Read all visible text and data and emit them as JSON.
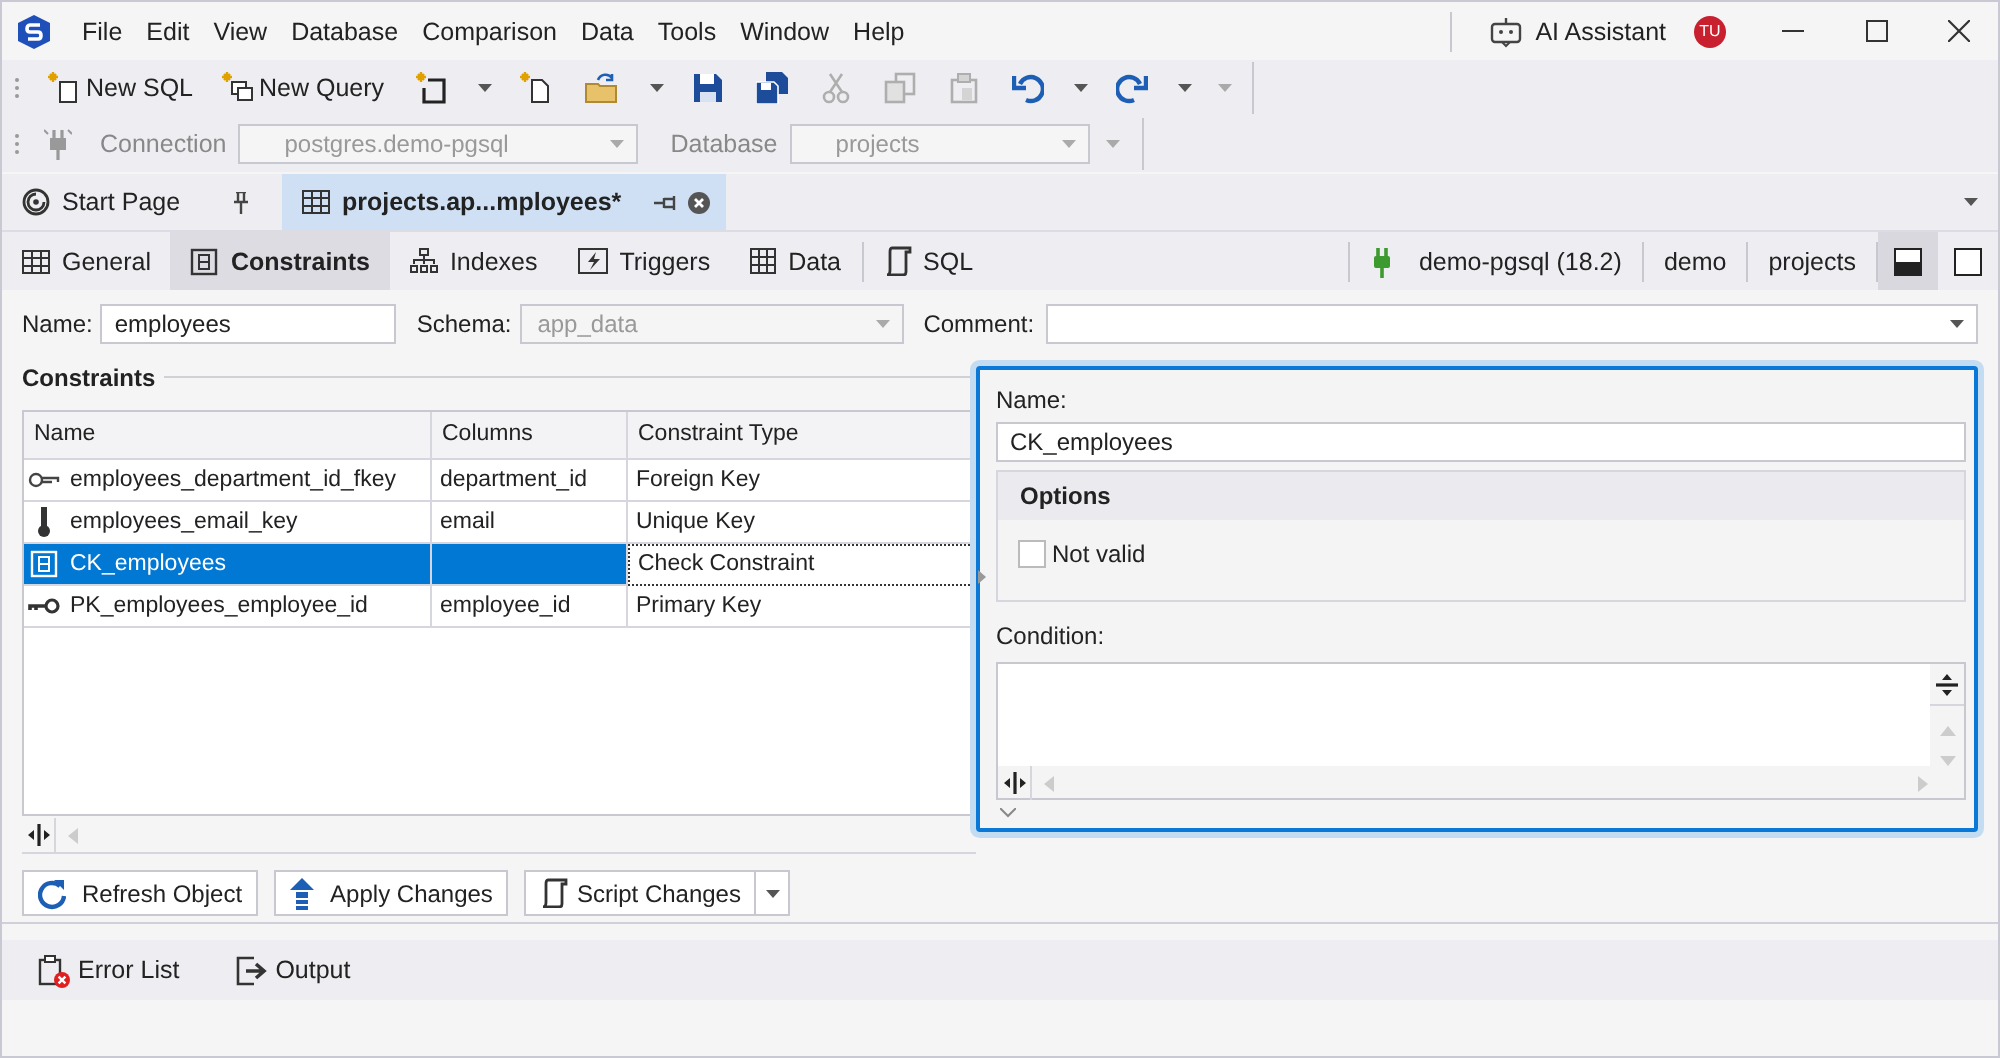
{
  "app": {
    "menu": [
      "File",
      "Edit",
      "View",
      "Database",
      "Comparison",
      "Data",
      "Tools",
      "Window",
      "Help"
    ],
    "ai_assistant": "AI Assistant",
    "user_initials": "TU"
  },
  "toolbar": [
    {
      "kind": "button",
      "label": "New SQL",
      "disabled": false
    },
    {
      "kind": "button",
      "label": "New Query",
      "disabled": false
    },
    {
      "kind": "button",
      "disabled": false
    },
    {
      "kind": "dropdown",
      "disabled": false
    },
    {
      "kind": "button",
      "disabled": false
    },
    {
      "kind": "button",
      "disabled": false
    },
    {
      "kind": "dropdown",
      "disabled": false
    },
    {
      "kind": "button",
      "disabled": false
    },
    {
      "kind": "button",
      "disabled": false
    },
    {
      "kind": "button",
      "disabled": true
    },
    {
      "kind": "button",
      "disabled": true
    },
    {
      "kind": "button",
      "disabled": true
    },
    {
      "kind": "button",
      "disabled": false
    },
    {
      "kind": "dropdown",
      "disabled": false
    },
    {
      "kind": "button",
      "disabled": false
    },
    {
      "kind": "dropdown",
      "disabled": false
    }
  ],
  "connection_bar": {
    "connection_label": "Connection",
    "connection_value": "postgres.demo-pgsql",
    "database_label": "Database",
    "database_value": "projects"
  },
  "doc_tabs": [
    {
      "label": "Start Page",
      "selected": false
    },
    {
      "label": "projects.ap...mployees*",
      "selected": true
    }
  ],
  "editor_tabs": [
    {
      "label": "General",
      "selected": false
    },
    {
      "label": "Constraints",
      "selected": true
    },
    {
      "label": "Indexes",
      "selected": false
    },
    {
      "label": "Triggers",
      "selected": false
    },
    {
      "label": "Data",
      "selected": false
    },
    {
      "label": "SQL",
      "selected": false
    }
  ],
  "status": {
    "connection": "demo-pgsql (18.2)",
    "schema": "demo",
    "database": "projects"
  },
  "view_modes": [
    {
      "selected": true
    },
    {
      "selected": false
    }
  ],
  "form": {
    "name_label": "Name:",
    "name_value": "employees",
    "schema_label": "Schema:",
    "schema_value": "app_data",
    "comment_label": "Comment:"
  },
  "constraints": {
    "title": "Constraints",
    "columns": [
      "Name",
      "Columns",
      "Constraint Type"
    ],
    "rows": [
      {
        "kind": "foreign",
        "name": "employees_department_id_fkey",
        "columns": "department_id",
        "type": "Foreign Key",
        "selected": false
      },
      {
        "kind": "unique",
        "name": "employees_email_key",
        "columns": "email",
        "type": "Unique Key",
        "selected": false
      },
      {
        "kind": "check",
        "name": "CK_employees",
        "columns": "",
        "type": "Check Constraint",
        "selected": true
      },
      {
        "kind": "primary",
        "name": "PK_employees_employee_id",
        "columns": "employee_id",
        "type": "Primary Key",
        "selected": false
      }
    ]
  },
  "detail": {
    "name_label": "Name:",
    "name_value": "CK_employees",
    "options_title": "Options",
    "not_valid": {
      "label": "Not valid",
      "checked": false
    },
    "condition_label": "Condition:"
  },
  "actions": [
    "Refresh Object",
    "Apply Changes",
    "Script Changes"
  ],
  "bottom_tabs": [
    "Error List",
    "Output"
  ]
}
